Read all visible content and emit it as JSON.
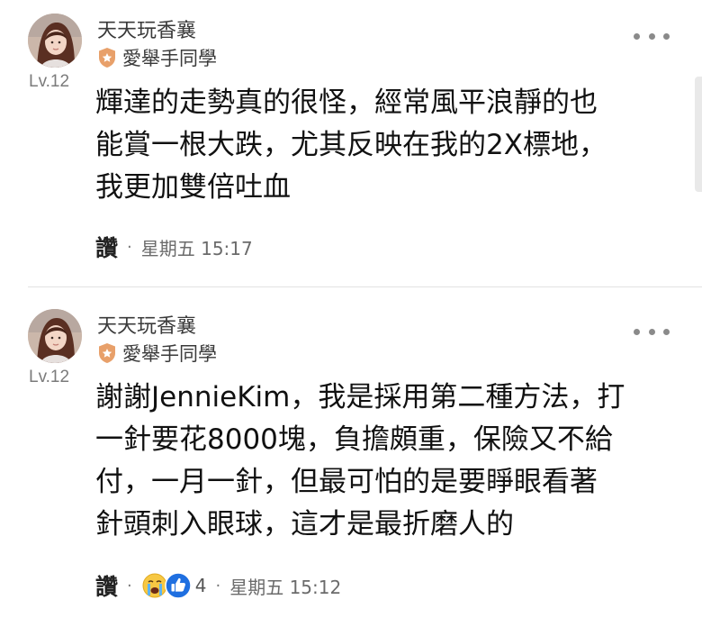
{
  "comments": [
    {
      "username": "天天玩香襄",
      "badge_label": "愛舉手同學",
      "level": "Lv.12",
      "body_lines": [
        "輝達的走勢真的很怪，經常風平浪靜的也",
        "能賞一根大跌，尤其反映在我的2X標地，",
        "我更加雙倍吐血"
      ],
      "like_label": "讚",
      "separator": "·",
      "timestamp": "星期五 15:17",
      "avatar_icon": "user-avatar-photo",
      "badge_icon": "shield-badge-icon",
      "more_icon": "more-options-icon"
    },
    {
      "username": "天天玩香襄",
      "badge_label": "愛舉手同學",
      "level": "Lv.12",
      "body_lines": [
        "謝謝JennieKim，我是採用第二種方法，打",
        "一針要花8000塊，負擔頗重，保險又不給",
        "付，一月一針，但最可怕的是要睜眼看著",
        "針頭刺入眼球，這才是最折磨人的"
      ],
      "like_label": "讚",
      "separator": "·",
      "reaction_icons": [
        "crying-emoji-icon",
        "thumbs-up-icon"
      ],
      "reaction_count": "4",
      "timestamp": "星期五 15:12",
      "avatar_icon": "user-avatar-photo",
      "badge_icon": "shield-badge-icon",
      "more_icon": "more-options-icon"
    }
  ],
  "colors": {
    "badge_orange": "#e8a06a",
    "thumbs_blue": "#1f6fe0",
    "emoji_yellow": "#f7c843",
    "meta_gray": "#6b6b6b",
    "text_dark": "#111111"
  }
}
